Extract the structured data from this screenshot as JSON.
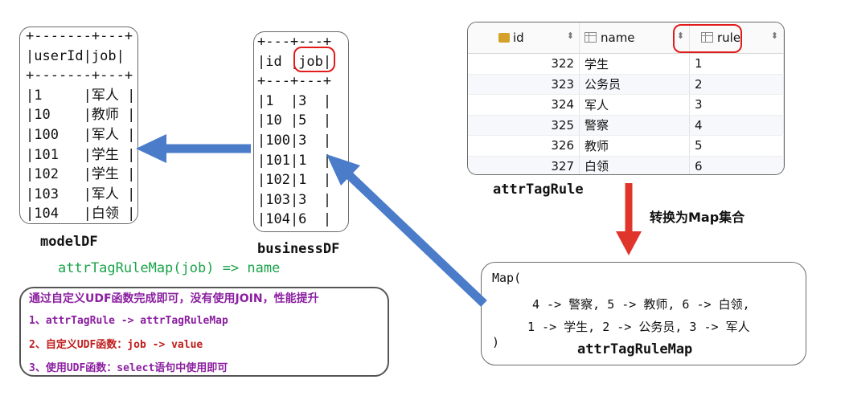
{
  "modelDF": {
    "label": "modelDF",
    "lines": [
      "+-------+---+",
      "|userId|job|",
      "+-------+---+",
      "|1     |军人 |",
      "|10    |教师 |",
      "|100   |军人 |",
      "|101   |学生 |",
      "|102   |学生 |",
      "|103   |军人 |",
      "|104   |白领 |"
    ]
  },
  "businessDF": {
    "label": "businessDF",
    "lines": [
      "+---+---+",
      "|id |job|",
      "+---+---+",
      "|1  |3  |",
      "|10 |5  |",
      "|100|3  |",
      "|101|1  |",
      "|102|1  |",
      "|103|3  |",
      "|104|6  |"
    ]
  },
  "attrTagRule": {
    "label": "attrTagRule",
    "columns": [
      "id",
      "name",
      "rule"
    ],
    "rows": [
      [
        "322",
        "学生",
        "1"
      ],
      [
        "323",
        "公务员",
        "2"
      ],
      [
        "324",
        "军人",
        "3"
      ],
      [
        "325",
        "警察",
        "4"
      ],
      [
        "326",
        "教师",
        "5"
      ],
      [
        "327",
        "白领",
        "6"
      ]
    ]
  },
  "convert_label": "转换为Map集合",
  "map": {
    "open": "Map(",
    "line1": "4 -> 警察, 5 -> 教师, 6 -> 白领,",
    "line2": "1 -> 学生, 2 -> 公务员, 3 -> 军人",
    "close": ")",
    "label": "attrTagRuleMap"
  },
  "mapping_text": "attrTagRuleMap(job) => name",
  "note": {
    "line1": "通过自定义UDF函数完成即可，没有使用JOIN，性能提升",
    "line2": "1、attrTagRule -> attrTagRuleMap",
    "line3": "2、自定义UDF函数：job -> value",
    "line4": "3、使用UDF函数：select语句中使用即可"
  },
  "colors": {
    "arrow_blue": "#4a7cc9",
    "arrow_red": "#e0352b",
    "green": "#1aa34a",
    "purple": "#8b1fa0",
    "ring_red": "#e21b1b"
  }
}
